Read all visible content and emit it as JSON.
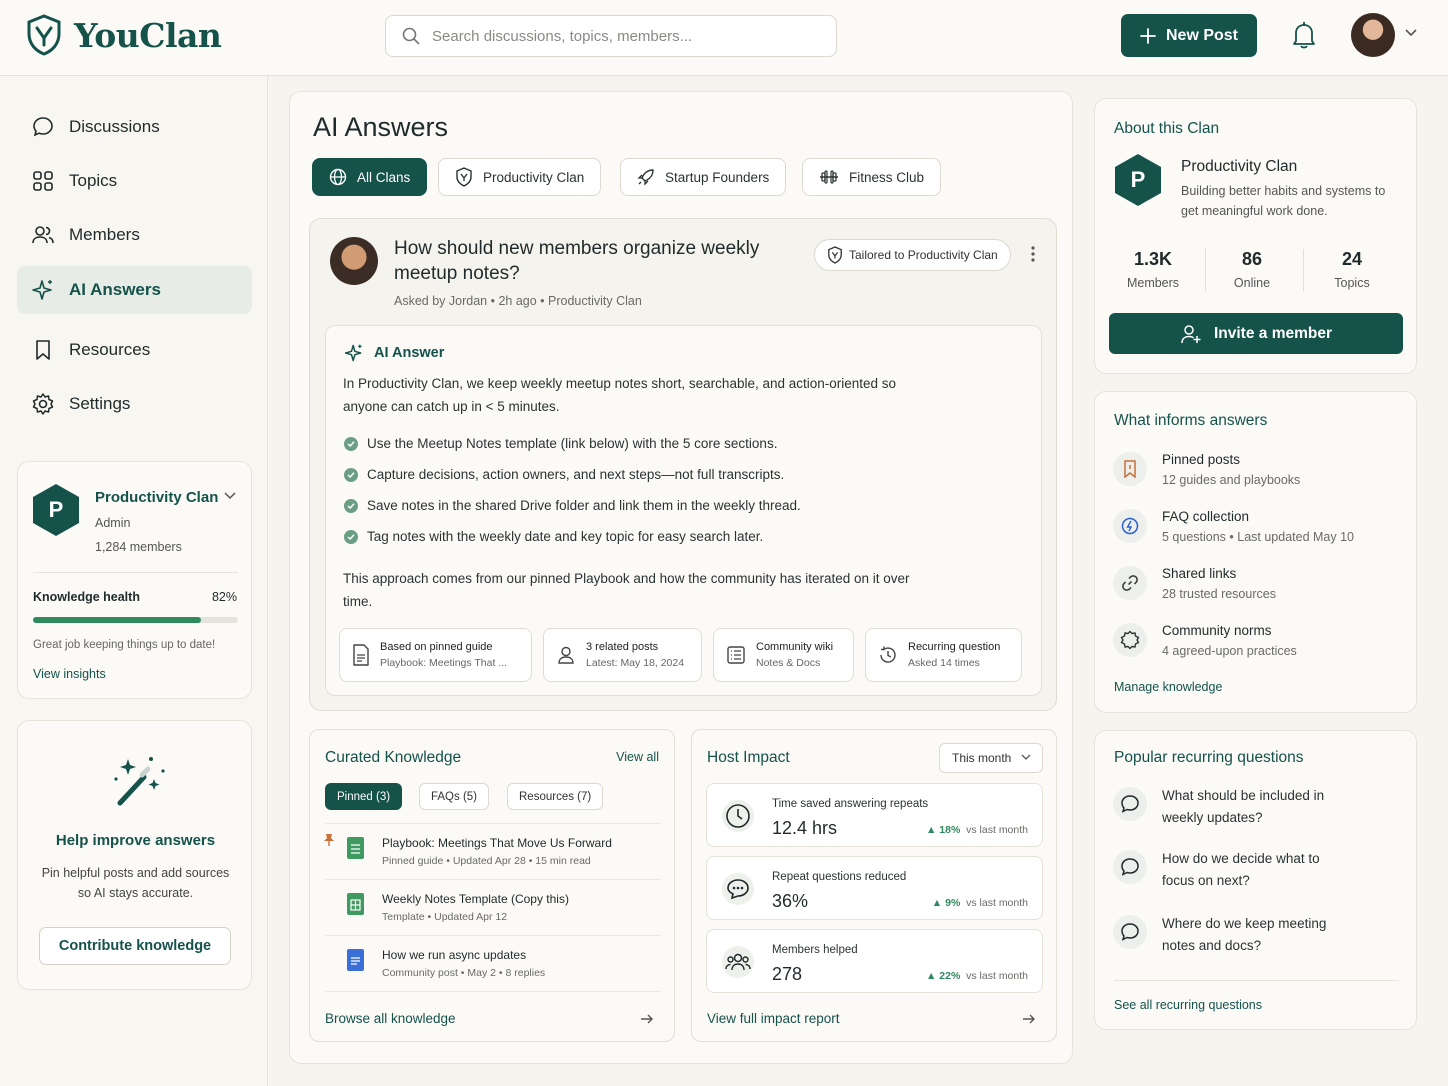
{
  "app": {
    "name": "YouClan"
  },
  "header": {
    "search_placeholder": "Search discussions, topics, members...",
    "new_post": "New Post"
  },
  "colors": {
    "brand": "#15524a",
    "success": "#2f8a5e",
    "background": "#f6f4ef"
  },
  "sidebar": {
    "nav": [
      {
        "label": "Discussions",
        "icon": "chat-bubble-icon"
      },
      {
        "label": "Topics",
        "icon": "grid-icon"
      },
      {
        "label": "Members",
        "icon": "members-icon"
      },
      {
        "label": "AI Answers",
        "icon": "sparkle-icon",
        "active": true
      },
      {
        "label": "Resources",
        "icon": "bookmark-icon"
      },
      {
        "label": "Settings",
        "icon": "gear-icon"
      }
    ],
    "clan": {
      "badge": "P",
      "name": "Productivity Clan",
      "role": "Admin",
      "members": "1,284 members",
      "health_label": "Knowledge health",
      "health_value": "82%",
      "health_fraction": 0.82,
      "health_note": "Great job keeping things up to date!",
      "insights_link": "View insights"
    },
    "help": {
      "title": "Help improve answers",
      "body": "Pin helpful posts and add sources so AI stays accurate.",
      "button": "Contribute knowledge"
    }
  },
  "main": {
    "title": "AI Answers",
    "filters": [
      {
        "label": "All Clans",
        "icon": "globe-icon",
        "active": true
      },
      {
        "label": "Productivity Clan",
        "icon": "shield-icon"
      },
      {
        "label": "Startup Founders",
        "icon": "rocket-icon"
      },
      {
        "label": "Fitness Club",
        "icon": "dumbbell-icon"
      }
    ],
    "question": {
      "title": "How should new members organize weekly meetup notes?",
      "asked_by": "Asked by Jordan",
      "time": "2h ago",
      "clan": "Productivity Clan",
      "tag": "Tailored to Productivity Clan"
    },
    "answer": {
      "heading": "AI Answer",
      "intro": "In Productivity Clan, we keep weekly meetup notes short, searchable, and action-oriented so anyone can catch up in < 5 minutes.",
      "bullets": [
        "Use the Meetup Notes template (link below) with the 5 core sections.",
        "Capture decisions, action owners, and next steps—not full transcripts.",
        "Save notes in the shared Drive folder and link them in the weekly thread.",
        "Tag notes with the weekly date and key topic for easy search later."
      ],
      "outro": "This approach comes from our pinned Playbook and how the community has iterated on it over time.",
      "sources": [
        {
          "t1": "Based on pinned guide",
          "t2": "Playbook: Meetings That ...",
          "icon": "document-icon"
        },
        {
          "t1": "3 related posts",
          "t2": "Latest: May 18, 2024",
          "icon": "person-icon"
        },
        {
          "t1": "Community wiki",
          "t2": "Notes & Docs",
          "icon": "wiki-icon"
        },
        {
          "t1": "Recurring question",
          "t2": "Asked 14 times",
          "icon": "history-icon"
        }
      ]
    },
    "curated": {
      "title": "Curated Knowledge",
      "view_all": "View all",
      "tabs": [
        "Pinned (3)",
        "FAQs (5)",
        "Resources (7)"
      ],
      "items": [
        {
          "title": "Playbook: Meetings That Move Us Forward",
          "meta": "Pinned guide  •  Updated Apr 28  •  15 min read",
          "color": "#3f9a5f"
        },
        {
          "title": "Weekly Notes Template (Copy this)",
          "meta": "Template  •  Updated Apr 12",
          "color": "#3f9a5f"
        },
        {
          "title": "How we run async updates",
          "meta": "Community post  •  May 2  •  8 replies",
          "color": "#3b6fd8"
        }
      ],
      "browse": "Browse all knowledge"
    },
    "impact": {
      "title": "Host Impact",
      "period": "This month",
      "metrics": [
        {
          "label": "Time saved answering repeats",
          "value": "12.4 hrs",
          "delta": "18%",
          "delta_note": "vs last month",
          "icon": "clock-icon"
        },
        {
          "label": "Repeat questions reduced",
          "value": "36%",
          "delta": "9%",
          "delta_note": "vs last month",
          "icon": "chat-dots-icon"
        },
        {
          "label": "Members helped",
          "value": "278",
          "delta": "22%",
          "delta_note": "vs last month",
          "icon": "group-icon"
        }
      ],
      "report": "View full impact report"
    }
  },
  "right": {
    "about": {
      "title": "About this Clan",
      "badge": "P",
      "name": "Productivity Clan",
      "desc": "Building better habits and systems to get meaningful work done.",
      "stats": [
        {
          "value": "1.3K",
          "label": "Members"
        },
        {
          "value": "86",
          "label": "Online"
        },
        {
          "value": "24",
          "label": "Topics"
        }
      ],
      "invite": "Invite a member"
    },
    "informs": {
      "title": "What informs answers",
      "items": [
        {
          "title": "Pinned posts",
          "sub": "12 guides and playbooks",
          "icon": "pin-bookmark-icon"
        },
        {
          "title": "FAQ collection",
          "sub": "5 questions • Last updated May 10",
          "icon": "faq-icon"
        },
        {
          "title": "Shared links",
          "sub": "28 trusted resources",
          "icon": "link-icon"
        },
        {
          "title": "Community norms",
          "sub": "4 agreed-upon practices",
          "icon": "norms-icon"
        }
      ],
      "manage": "Manage knowledge"
    },
    "recurring": {
      "title": "Popular recurring questions",
      "items": [
        "What should be included in weekly updates?",
        "How do we decide what to focus on next?",
        "Where do we keep meeting notes and docs?"
      ],
      "see_all": "See all recurring questions"
    }
  }
}
